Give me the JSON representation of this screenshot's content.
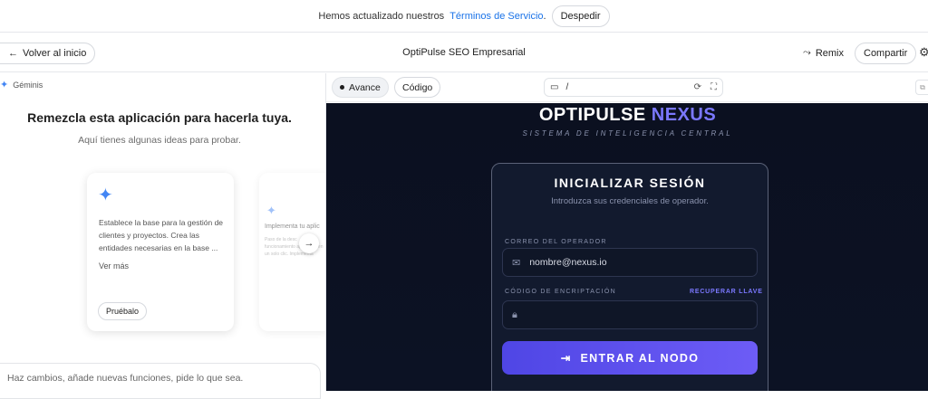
{
  "banner": {
    "text": "Hemos actualizado nuestros",
    "link": "Términos de Servicio",
    "period": ".",
    "dismiss": "Despedir"
  },
  "topbar": {
    "back": "Volver al inicio",
    "title": "OptiPulse SEO Empresarial",
    "remix": "Remix",
    "share": "Compartir"
  },
  "left": {
    "gemini_label": "Géminis",
    "heading": "Remezcla esta aplicación para hacerla tuya.",
    "subheading": "Aquí tienes algunas ideas para probar.",
    "card1": {
      "desc": "Establece la base para la gestión de clientes y proyectos. Crea las entidades necesarias en la base ...",
      "more": "Ver más",
      "try": "Pruébalo"
    },
    "card2": {
      "title": "Implementa tu aplic",
      "body": "Paso de la desc funcionamiento aplicación en un solo clic. Implementa"
    },
    "prompt_placeholder": "Haz cambios, añade nuevas funciones, pide lo que sea."
  },
  "preview_toolbar": {
    "tab_preview": "Avance",
    "tab_code": "Código",
    "path": "/"
  },
  "app": {
    "brand_a": "OPTIPULSE",
    "brand_b": "NEXUS",
    "tagline": "SISTEMA DE INTELIGENCIA CENTRAL",
    "login_title": "INICIALIZAR SESIÓN",
    "login_sub": "Introduzca sus credenciales de operador.",
    "email_label": "CORREO DEL OPERADOR",
    "email_placeholder": "nombre@nexus.io",
    "code_label": "CÓDIGO DE ENCRIPTACIÓN",
    "recover": "RECUPERAR LLAVE",
    "submit": "ENTRAR AL NODO"
  },
  "icons": [
    "arrow-left-icon",
    "remix-icon",
    "gear-icon",
    "sparkle-icon",
    "arrow-right-icon",
    "device-icon",
    "refresh-icon",
    "fullscreen-icon",
    "mail-icon",
    "lock-icon",
    "login-icon"
  ],
  "colors": {
    "link": "#1a73e8",
    "accent": "#6d5cf6",
    "preview_bg": "#0b1020"
  }
}
